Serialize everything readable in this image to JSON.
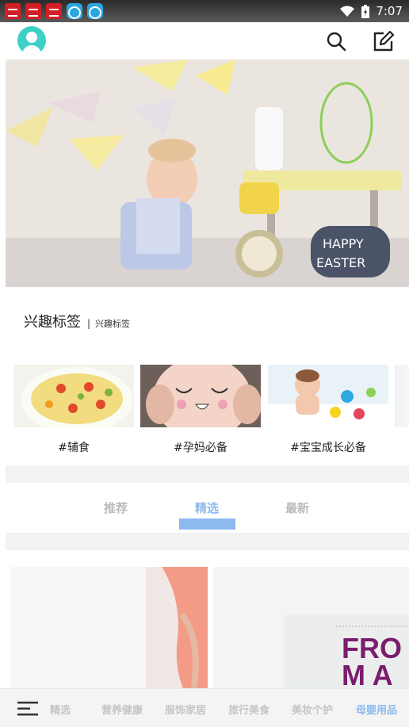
{
  "status_bar": {
    "time": "7:07",
    "notification_icons": [
      "red-app-icon",
      "red-app-icon",
      "red-app-icon",
      "blue-app-icon",
      "blue-app-icon"
    ]
  },
  "header": {
    "avatar_icon": "user-avatar-icon",
    "search_icon": "search-icon",
    "compose_icon": "edit-icon"
  },
  "interest_tags": {
    "title": "兴趣标签",
    "subtitle": "兴趣标签",
    "items": [
      {
        "label": "#辅食"
      },
      {
        "label": "#孕妈必备"
      },
      {
        "label": "#宝宝成长必备"
      }
    ]
  },
  "tabs": {
    "items": [
      {
        "label": "推荐"
      },
      {
        "label": "精选"
      },
      {
        "label": "最新"
      }
    ],
    "active": "精选"
  },
  "feed": {
    "card_2_text": "FROM AUST"
  },
  "bottom_nav": {
    "menu_icon": "menu-icon",
    "items": [
      {
        "label": "精选"
      },
      {
        "label": "营养健康"
      },
      {
        "label": "服饰家居"
      },
      {
        "label": "旅行美食"
      },
      {
        "label": "美妆个护"
      },
      {
        "label": "母婴用品"
      }
    ],
    "active": "母婴用品"
  },
  "colors": {
    "accent": "#8db9ee",
    "avatar": "#3ecfc6",
    "inactive_text": "#bbbbbb"
  }
}
